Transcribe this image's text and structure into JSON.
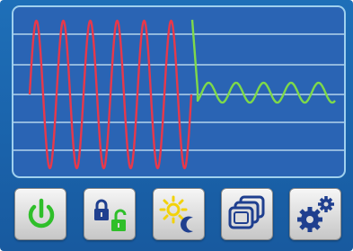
{
  "colors": {
    "panel_background": "#1e6fb8",
    "screen_background": "#2a64b4",
    "screen_border": "#9fd0ee",
    "grid_line": "#cfe9f8",
    "trace_before": "#e8384a",
    "trace_after": "#7ed94a"
  },
  "toolbar": {
    "buttons": [
      {
        "icon": "power-icon",
        "color": "#2fbf2a"
      },
      {
        "icon": "lock-unlock-icon",
        "color": "#1f3f8f",
        "accent": "#2fbf2a"
      },
      {
        "icon": "sun-moon-icon",
        "color": "#f2d20a",
        "accent": "#1f3f8f"
      },
      {
        "icon": "stacked-windows-icon",
        "color": "#1f3f8f"
      },
      {
        "icon": "gears-icon",
        "color": "#1f3f8f"
      }
    ]
  }
}
